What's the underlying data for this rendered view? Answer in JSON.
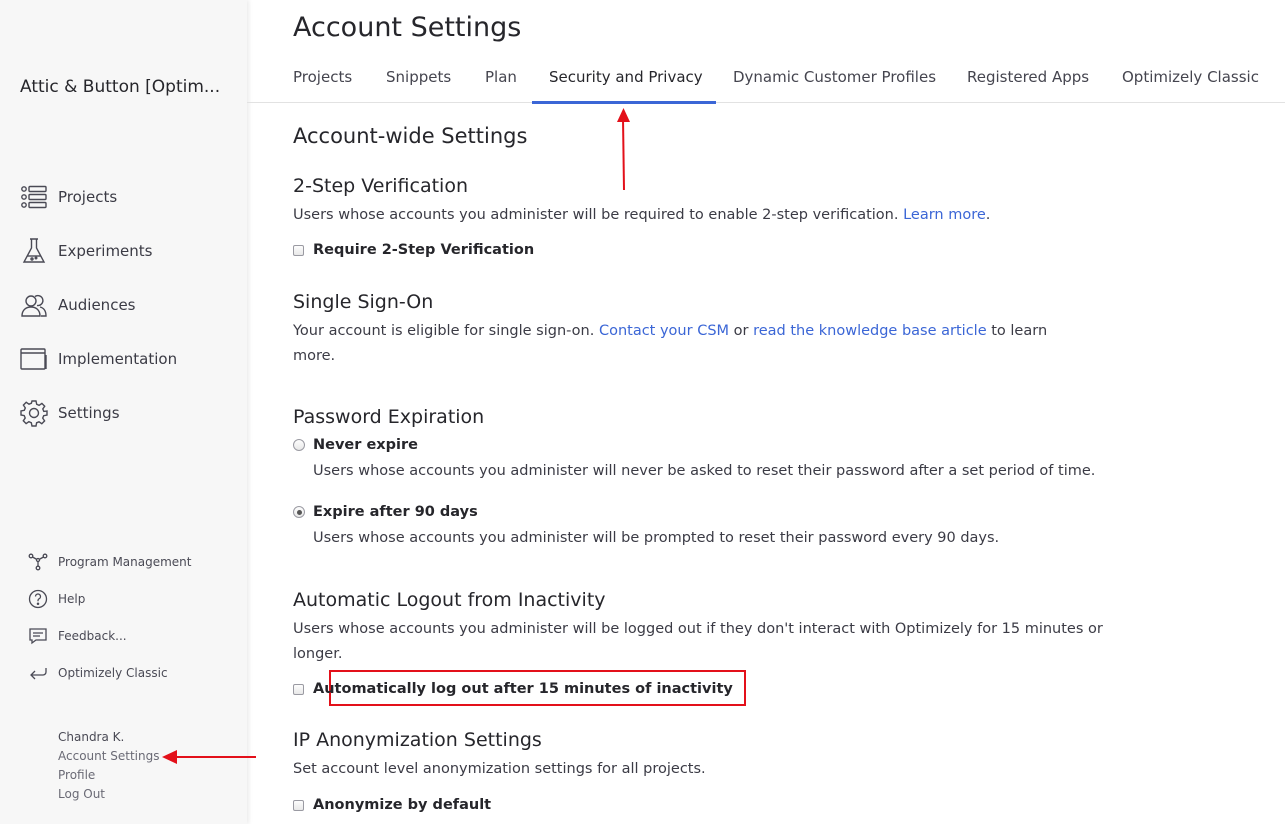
{
  "sidebar": {
    "org_name": "Attic & Button [Optim...",
    "nav": [
      {
        "label": "Projects",
        "icon": "projects-list-icon"
      },
      {
        "label": "Experiments",
        "icon": "flask-icon"
      },
      {
        "label": "Audiences",
        "icon": "people-icon"
      },
      {
        "label": "Implementation",
        "icon": "code-window-icon"
      },
      {
        "label": "Settings",
        "icon": "gear-icon"
      }
    ],
    "secondary": [
      {
        "label": "Program Management",
        "icon": "program-graph-icon"
      },
      {
        "label": "Help",
        "icon": "question-circle-icon"
      },
      {
        "label": "Feedback...",
        "icon": "feedback-bubble-icon"
      },
      {
        "label": "Optimizely Classic",
        "icon": "return-arrow-icon"
      }
    ],
    "user": {
      "name": "Chandra K.",
      "links": [
        "Account Settings",
        "Profile",
        "Log Out"
      ]
    }
  },
  "header": {
    "title": "Account Settings",
    "tabs": [
      {
        "label": "Projects",
        "active": false
      },
      {
        "label": "Snippets",
        "active": false
      },
      {
        "label": "Plan",
        "active": false
      },
      {
        "label": "Security and Privacy",
        "active": true
      },
      {
        "label": "Dynamic Customer Profiles",
        "active": false
      },
      {
        "label": "Registered Apps",
        "active": false
      },
      {
        "label": "Optimizely Classic",
        "active": false
      }
    ]
  },
  "content": {
    "heading": "Account-wide Settings",
    "two_step": {
      "title": "2-Step Verification",
      "desc": "Users whose accounts you administer will be required to enable 2-step verification.",
      "link": "Learn more",
      "desc_end": ".",
      "checkbox_label": "Require 2-Step Verification",
      "checked": false
    },
    "sso": {
      "title": "Single Sign-On",
      "desc_1": "Your account is eligible for single sign-on.",
      "link_1": "Contact your CSM",
      "desc_2": "or",
      "link_2": "read the knowledge base article",
      "desc_3": "to learn more."
    },
    "password": {
      "title": "Password Expiration",
      "options": [
        {
          "label": "Never expire",
          "desc": "Users whose accounts you administer will never be asked to reset their password after a set period of time.",
          "selected": false
        },
        {
          "label": "Expire after 90 days",
          "desc": "Users whose accounts you administer will be prompted to reset their password every 90 days.",
          "selected": true
        }
      ]
    },
    "auto_logout": {
      "title": "Automatic Logout from Inactivity",
      "desc": "Users whose accounts you administer will be logged out if they don't interact with Optimizely for 15 minutes or longer.",
      "checkbox_label": "Automatically log out after 15 minutes of inactivity",
      "checked": false
    },
    "ip": {
      "title": "IP Anonymization Settings",
      "desc": "Set account level anonymization settings for all projects.",
      "checkbox_label": "Anonymize by default",
      "checked": false
    }
  },
  "colors": {
    "accent": "#3b66d6",
    "annotation": "#e3101a",
    "sidebar_bg": "#f7f7f7"
  }
}
